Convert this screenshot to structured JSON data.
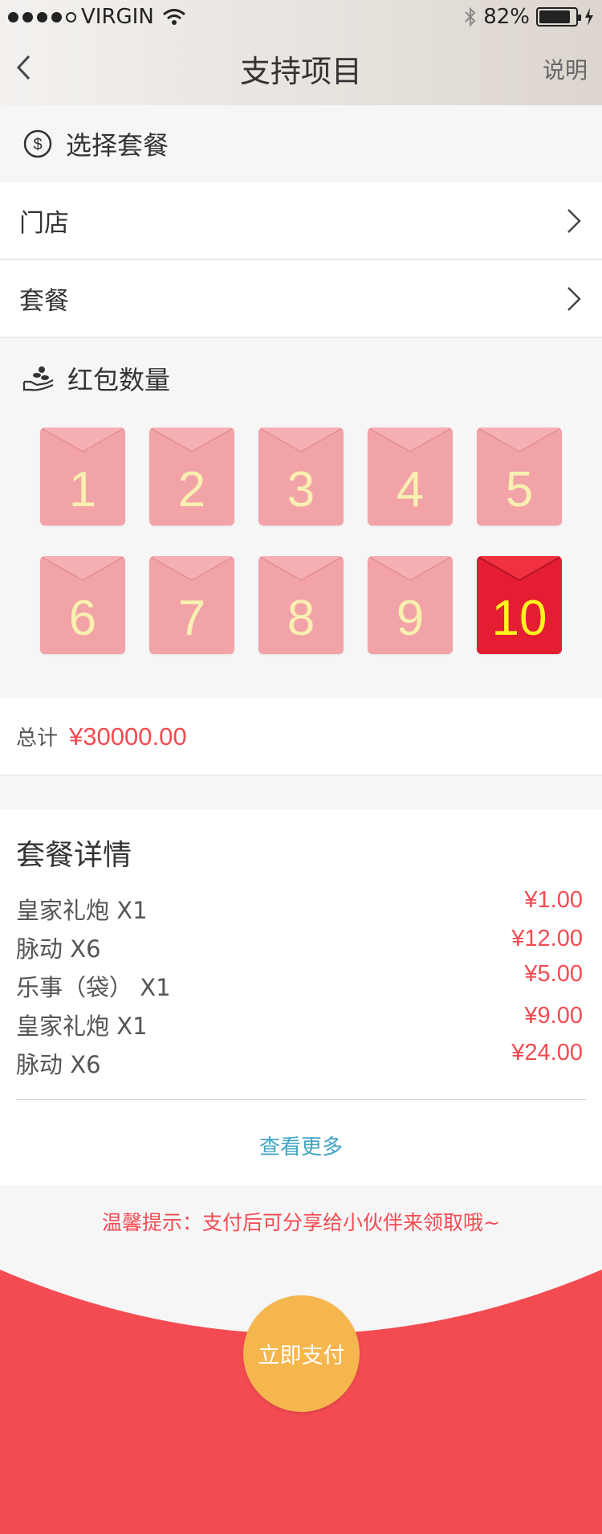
{
  "status_bar": {
    "carrier": "VIRGIN",
    "battery": "82%"
  },
  "nav": {
    "title": "支持项目",
    "help": "说明"
  },
  "select_package": {
    "title": "选择套餐",
    "rows": [
      {
        "label": "门店"
      },
      {
        "label": "套餐"
      }
    ]
  },
  "red_packet": {
    "title": "红包数量",
    "options": [
      "1",
      "2",
      "3",
      "4",
      "5",
      "6",
      "7",
      "8",
      "9",
      "10"
    ],
    "selected": "10"
  },
  "total": {
    "label": "总计",
    "amount": "¥30000.00"
  },
  "details": {
    "title": "套餐详情",
    "items": [
      {
        "name": "皇家礼炮  X1",
        "price": "¥1.00"
      },
      {
        "name": "脉动  X6",
        "price": "¥12.00"
      },
      {
        "name": "乐事（袋） X1",
        "price": "¥5.00"
      },
      {
        "name": "皇家礼炮  X1",
        "price": "¥9.00"
      },
      {
        "name": "脉动  X6",
        "price": "¥24.00"
      }
    ],
    "more": "查看更多"
  },
  "tip": "温馨提示：支付后可分享给小伙伴来领取哦~",
  "pay_button": "立即支付",
  "colors": {
    "accent_red": "#f44b52",
    "envelope": "#f2a3a7",
    "envelope_active": "#e41d32",
    "pay": "#f6b64e",
    "link": "#42a6c4"
  }
}
